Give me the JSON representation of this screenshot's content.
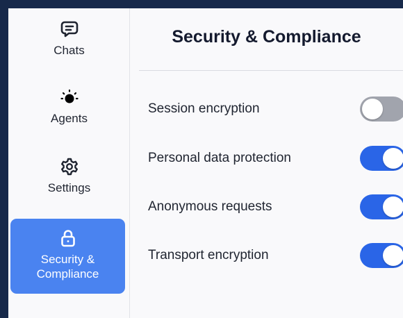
{
  "sidebar": {
    "items": [
      {
        "label": "Chats",
        "icon": "chat-bubble-icon",
        "active": false
      },
      {
        "label": "Agents",
        "icon": "bulb-icon",
        "active": false
      },
      {
        "label": "Settings",
        "icon": "gear-icon",
        "active": false
      },
      {
        "label": "Security &\nCompliance",
        "icon": "lock-icon",
        "active": true
      }
    ]
  },
  "main": {
    "title": "Security & Compliance",
    "settings": [
      {
        "label": "Session encryption",
        "enabled": false
      },
      {
        "label": "Personal data protection",
        "enabled": true
      },
      {
        "label": "Anonymous requests",
        "enabled": true
      },
      {
        "label": "Transport encryption",
        "enabled": true
      }
    ]
  },
  "colors": {
    "background": "#17294a",
    "panel": "#f9f9fb",
    "accent": "#4a83f0",
    "toggle_on": "#2a65e7",
    "toggle_off": "#a1a4ad"
  }
}
